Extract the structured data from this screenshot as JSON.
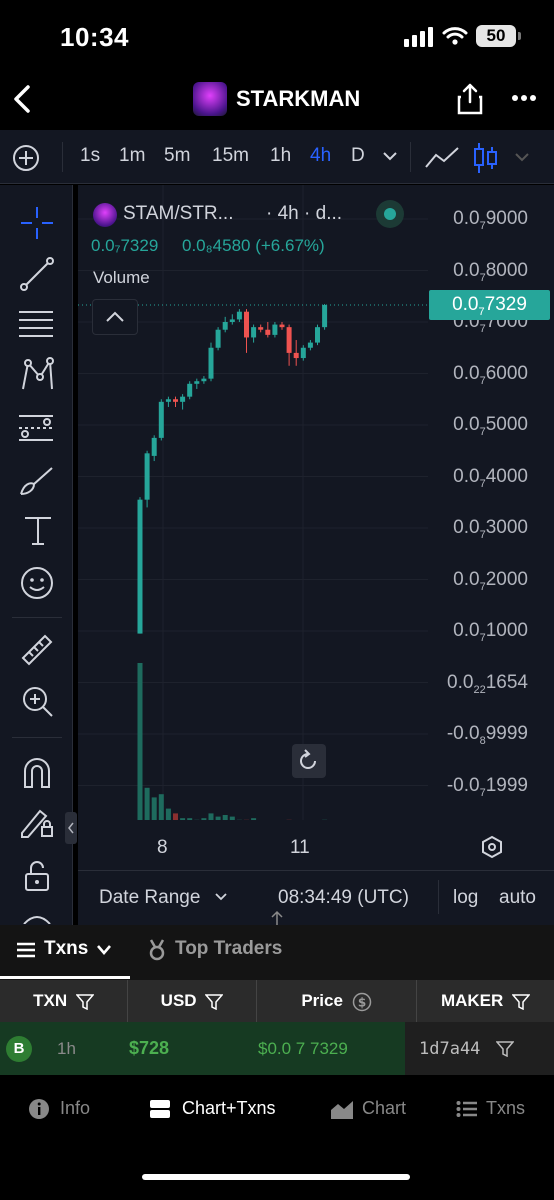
{
  "status_bar": {
    "time": "10:34",
    "battery": "50"
  },
  "nav": {
    "title": "STARKMAN"
  },
  "chart_toolbar": {
    "timeframes": [
      "1s",
      "1m",
      "5m",
      "15m",
      "1h",
      "4h",
      "D"
    ],
    "active_timeframe": "4h"
  },
  "chart_header": {
    "symbol": "STAM/STR...",
    "interval": "· 4h · d...",
    "open": "0.0₇7329",
    "change": "0.0₈4580 (+6.67%)",
    "volume_label": "Volume"
  },
  "current_price_tag": {
    "prefix": "0.0",
    "sub": "7",
    "digits": "7329"
  },
  "price_axis": [
    {
      "prefix": "0.0",
      "sub": "7",
      "digits": "9000"
    },
    {
      "prefix": "0.0",
      "sub": "7",
      "digits": "8000"
    },
    {
      "prefix": "0.0",
      "sub": "7",
      "digits": "7000"
    },
    {
      "prefix": "0.0",
      "sub": "7",
      "digits": "6000"
    },
    {
      "prefix": "0.0",
      "sub": "7",
      "digits": "5000"
    },
    {
      "prefix": "0.0",
      "sub": "7",
      "digits": "4000"
    },
    {
      "prefix": "0.0",
      "sub": "7",
      "digits": "3000"
    },
    {
      "prefix": "0.0",
      "sub": "7",
      "digits": "2000"
    },
    {
      "prefix": "0.0",
      "sub": "7",
      "digits": "1000"
    },
    {
      "prefix": "0.0",
      "sub": "22",
      "digits": "1654"
    },
    {
      "prefix": "-0.0",
      "sub": "8",
      "digits": "9999"
    },
    {
      "prefix": "-0.0",
      "sub": "7",
      "digits": "1999"
    }
  ],
  "time_axis": [
    "8",
    "11"
  ],
  "bottom_strip": {
    "date_range": "Date Range",
    "clock": "08:34:49 (UTC)",
    "log": "log",
    "auto": "auto"
  },
  "txn_tabs": {
    "txns": "Txns",
    "top_traders": "Top Traders"
  },
  "table": {
    "headers": [
      "TXN",
      "USD",
      "Price",
      "MAKER"
    ],
    "rows": [
      {
        "side": "B",
        "age": "1h",
        "usd": "$728",
        "price": "$0.0 7 7329",
        "maker": "1d7a44"
      }
    ]
  },
  "bottom_nav": [
    "Info",
    "Chart+Txns",
    "Chart",
    "Txns"
  ],
  "colors": {
    "up": "#26a69a",
    "down": "#ef5350",
    "accent": "#2962ff",
    "buy": "#2e7d32"
  },
  "chart_data": {
    "type": "candlestick",
    "series": [
      {
        "name": "price",
        "candles": [
          {
            "o": 0.95,
            "h": 3.6,
            "l": 0.95,
            "c": 3.55
          },
          {
            "o": 3.55,
            "h": 4.5,
            "l": 3.4,
            "c": 4.45
          },
          {
            "o": 4.4,
            "h": 4.8,
            "l": 4.3,
            "c": 4.75
          },
          {
            "o": 4.75,
            "h": 5.5,
            "l": 4.7,
            "c": 5.45
          },
          {
            "o": 5.45,
            "h": 5.55,
            "l": 5.35,
            "c": 5.5
          },
          {
            "o": 5.5,
            "h": 5.55,
            "l": 5.35,
            "c": 5.45
          },
          {
            "o": 5.45,
            "h": 5.6,
            "l": 5.3,
            "c": 5.55
          },
          {
            "o": 5.55,
            "h": 5.85,
            "l": 5.5,
            "c": 5.8
          },
          {
            "o": 5.8,
            "h": 5.9,
            "l": 5.7,
            "c": 5.85
          },
          {
            "o": 5.85,
            "h": 5.95,
            "l": 5.8,
            "c": 5.9
          },
          {
            "o": 5.9,
            "h": 6.6,
            "l": 5.85,
            "c": 6.5
          },
          {
            "o": 6.5,
            "h": 6.9,
            "l": 6.45,
            "c": 6.85
          },
          {
            "o": 6.85,
            "h": 7.1,
            "l": 6.8,
            "c": 7.0
          },
          {
            "o": 7.0,
            "h": 7.15,
            "l": 6.95,
            "c": 7.05
          },
          {
            "o": 7.05,
            "h": 7.25,
            "l": 7.0,
            "c": 7.2
          },
          {
            "o": 7.2,
            "h": 7.25,
            "l": 6.4,
            "c": 6.7
          },
          {
            "o": 6.7,
            "h": 6.95,
            "l": 6.6,
            "c": 6.9
          },
          {
            "o": 6.9,
            "h": 6.95,
            "l": 6.8,
            "c": 6.85
          },
          {
            "o": 6.85,
            "h": 7.0,
            "l": 6.7,
            "c": 6.75
          },
          {
            "o": 6.75,
            "h": 7.0,
            "l": 6.7,
            "c": 6.95
          },
          {
            "o": 6.95,
            "h": 7.0,
            "l": 6.85,
            "c": 6.9
          },
          {
            "o": 6.9,
            "h": 6.95,
            "l": 6.15,
            "c": 6.4
          },
          {
            "o": 6.4,
            "h": 6.65,
            "l": 6.15,
            "c": 6.3
          },
          {
            "o": 6.3,
            "h": 6.55,
            "l": 6.25,
            "c": 6.5
          },
          {
            "o": 6.5,
            "h": 6.65,
            "l": 6.45,
            "c": 6.6
          },
          {
            "o": 6.6,
            "h": 6.95,
            "l": 6.55,
            "c": 6.9
          },
          {
            "o": 6.9,
            "h": 7.35,
            "l": 6.85,
            "c": 7.33
          }
        ]
      },
      {
        "name": "volume",
        "values": [
          100,
          22,
          16,
          18,
          9,
          6,
          3,
          3,
          2,
          3,
          6,
          4,
          5,
          4,
          2,
          2,
          3,
          1,
          1,
          1,
          1,
          2,
          1,
          1,
          1,
          1,
          2
        ]
      }
    ],
    "ylim": [
      -2,
      9
    ]
  }
}
